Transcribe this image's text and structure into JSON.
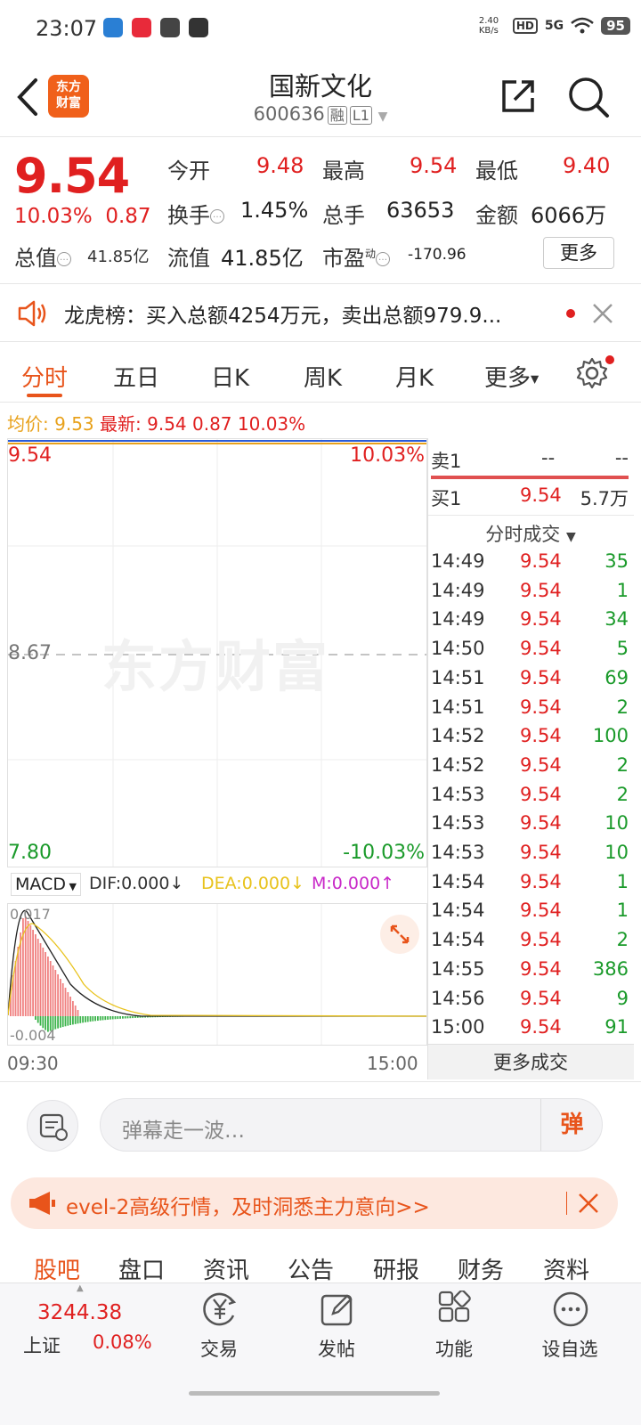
{
  "status": {
    "time": "23:07",
    "net_speed": "2.40 KB/s",
    "hd": "HD",
    "signal": "5G",
    "battery": "95"
  },
  "header": {
    "logo_line1": "东方",
    "logo_line2": "财富",
    "title": "国新文化",
    "code": "600636",
    "tag_rong": "融",
    "tag_level": "L1"
  },
  "quote": {
    "price": "9.54",
    "change_pct": "10.03%",
    "change": "0.87",
    "open_label": "今开",
    "open": "9.48",
    "high_label": "最高",
    "high": "9.54",
    "low_label": "最低",
    "low": "9.40",
    "turnover_label": "换手",
    "turnover": "1.45%",
    "volume_label": "总手",
    "volume": "63653",
    "amount_label": "金额",
    "amount": "6066万",
    "mktcap_label": "总值",
    "mktcap": "41.85亿",
    "float_label": "流值",
    "float": "41.85亿",
    "pe_label": "市盈",
    "pe_sup": "动",
    "pe": "-170.96",
    "more": "更多"
  },
  "notice": {
    "text": "龙虎榜：买入总额4254万元，卖出总额979.9..."
  },
  "tabs": [
    "分时",
    "五日",
    "日K",
    "周K",
    "月K",
    "更多"
  ],
  "avg_line": {
    "avg_label": "均价:",
    "avg": "9.53",
    "latest_label": "最新:",
    "latest": "9.54",
    "chg": "0.87",
    "pct": "10.03%"
  },
  "chart": {
    "top_price": "9.54",
    "top_pct": "10.03%",
    "mid_price": "8.67",
    "bottom_price": "7.80",
    "bottom_pct": "-10.03%",
    "watermark": "东方财富"
  },
  "macd": {
    "selector": "MACD",
    "dif": "DIF:0.000",
    "dea": "DEA:0.000",
    "m": "M:0.000",
    "top": "0.017",
    "bottom": "-0.004",
    "time_start": "09:30",
    "time_end": "15:00"
  },
  "orderbook": {
    "sell_label": "卖1",
    "sell_price": "--",
    "sell_vol": "--",
    "buy_label": "买1",
    "buy_price": "9.54",
    "buy_vol": "5.7万",
    "ticks_label": "分时成交"
  },
  "ticks": [
    {
      "t": "14:49",
      "p": "9.54",
      "v": "35"
    },
    {
      "t": "14:49",
      "p": "9.54",
      "v": "1"
    },
    {
      "t": "14:49",
      "p": "9.54",
      "v": "34"
    },
    {
      "t": "14:50",
      "p": "9.54",
      "v": "5"
    },
    {
      "t": "14:51",
      "p": "9.54",
      "v": "69"
    },
    {
      "t": "14:51",
      "p": "9.54",
      "v": "2"
    },
    {
      "t": "14:52",
      "p": "9.54",
      "v": "100"
    },
    {
      "t": "14:52",
      "p": "9.54",
      "v": "2"
    },
    {
      "t": "14:53",
      "p": "9.54",
      "v": "2"
    },
    {
      "t": "14:53",
      "p": "9.54",
      "v": "10"
    },
    {
      "t": "14:53",
      "p": "9.54",
      "v": "10"
    },
    {
      "t": "14:54",
      "p": "9.54",
      "v": "1"
    },
    {
      "t": "14:54",
      "p": "9.54",
      "v": "1"
    },
    {
      "t": "14:54",
      "p": "9.54",
      "v": "2"
    },
    {
      "t": "14:55",
      "p": "9.54",
      "v": "386"
    },
    {
      "t": "14:56",
      "p": "9.54",
      "v": "9"
    },
    {
      "t": "15:00",
      "p": "9.54",
      "v": "91"
    }
  ],
  "more_ticks": "更多成交",
  "danmu": {
    "placeholder": "弹幕走一波…",
    "button": "弹"
  },
  "banner": {
    "text": "evel-2高级行情，及时洞悉主力意向>>"
  },
  "subtabs": [
    "股吧",
    "盘口",
    "资讯",
    "公告",
    "研报",
    "财务",
    "资料"
  ],
  "bottom": {
    "index_value": "3244.38",
    "index_name": "上证",
    "index_chg": "0.08%",
    "items": [
      "交易",
      "发帖",
      "功能",
      "设自选"
    ]
  },
  "colors": {
    "up": "#e02020",
    "down": "#1a9a2a",
    "accent": "#e8541b",
    "avg": "#e8a11b"
  }
}
